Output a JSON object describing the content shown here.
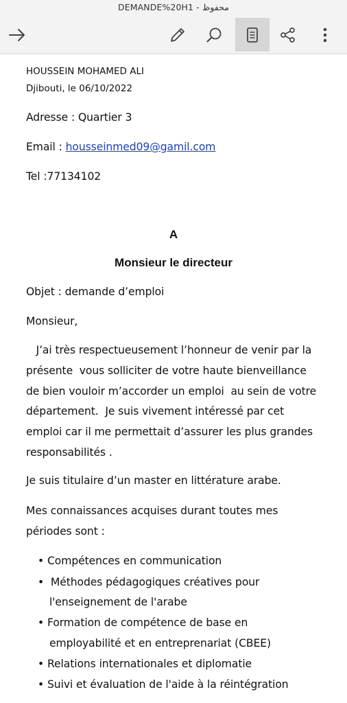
{
  "window": {
    "title": "DEMANDE%20H1 - محفوظ"
  },
  "toolbar": {
    "back_icon": "arrow-right-icon",
    "edit_icon": "pencil-icon",
    "search_icon": "search-icon",
    "reading_view_icon": "reading-view-icon",
    "share_icon": "share-icon",
    "more_icon": "more-vertical-icon"
  },
  "document": {
    "sender_name": "HOUSSEIN MOHAMED ALI",
    "place_date": "Djibouti,  le 06/10/2022",
    "address": "Adresse : Quartier 3",
    "email_label": "Email : ",
    "email_value": "housseinmed09@gamil.com",
    "tel": "Tel :77134102",
    "recipient_a": "A",
    "recipient": "Monsieur le directeur",
    "subject": "Objet : demande d’emploi",
    "salutation": "Monsieur,",
    "paragraph1": [
      "   J’ai très respectueusement l’honneur de venir par la",
      "présente  vous solliciter de votre haute bienveillance",
      "de bien vouloir m’accorder un emploi  au sein de votre",
      "département.  Je suis vivement intéressé par cet",
      "emploi car il me permettait d’assurer les plus grandes",
      "responsabilités ."
    ],
    "paragraph2": "Je suis titulaire d’un master en littérature arabe.",
    "paragraph3": [
      "Mes connaissances acquises durant toutes mes",
      "périodes sont :"
    ],
    "bullets": [
      {
        "lines": [
          "Compétences en communication"
        ]
      },
      {
        "lines": [
          " Méthodes pédagogiques créatives pour",
          "l'enseignement de l'arabe"
        ]
      },
      {
        "lines": [
          "Formation de compétence de base en",
          "employabilité et en entreprenariat (CBEE)"
        ]
      },
      {
        "lines": [
          "Relations internationales et diplomatie"
        ]
      },
      {
        "lines": [
          "Suivi et évaluation de l'aide à la réintégration"
        ]
      }
    ]
  },
  "colors": {
    "toolbar_bg": "#f3f3f3",
    "active_button_bg": "#d6d6d6",
    "link": "#1f3fbf"
  }
}
